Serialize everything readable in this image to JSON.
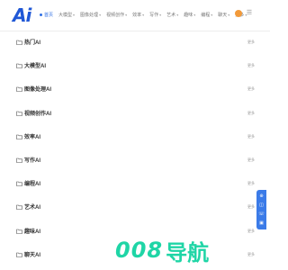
{
  "header": {
    "logo": "Ai",
    "nav": [
      {
        "label": "首页",
        "active": true,
        "has_caret": false
      },
      {
        "label": "大模型",
        "active": false,
        "has_caret": true
      },
      {
        "label": "图像处理",
        "active": false,
        "has_caret": true
      },
      {
        "label": "视频创作",
        "active": false,
        "has_caret": true
      },
      {
        "label": "效率",
        "active": false,
        "has_caret": true
      },
      {
        "label": "写作",
        "active": false,
        "has_caret": true
      },
      {
        "label": "艺术",
        "active": false,
        "has_caret": true
      },
      {
        "label": "趣味",
        "active": false,
        "has_caret": true
      },
      {
        "label": "编程",
        "active": false,
        "has_caret": true
      },
      {
        "label": "聊天",
        "active": false,
        "has_caret": true
      },
      {
        "label": "更多",
        "active": false,
        "has_caret": true
      }
    ]
  },
  "sections": [
    {
      "title": "热门AI",
      "more": "更多"
    },
    {
      "title": "大模型AI",
      "more": "更多"
    },
    {
      "title": "图像处理AI",
      "more": "更多"
    },
    {
      "title": "视频创作AI",
      "more": "更多"
    },
    {
      "title": "效率AI",
      "more": "更多"
    },
    {
      "title": "写作AI",
      "more": "更多"
    },
    {
      "title": "编程AI",
      "more": "更多"
    },
    {
      "title": "艺术AI",
      "more": "更多"
    },
    {
      "title": "趣味AI",
      "more": "更多"
    },
    {
      "title": "聊天AI",
      "more": "更多"
    }
  ],
  "side_tool": [
    "⊕",
    "◫",
    "☏",
    "▣"
  ],
  "watermark": {
    "number": "008",
    "text": "导航"
  },
  "colors": {
    "logo": "#1f57d6",
    "nav_active": "#2f6fe4",
    "side_tool": "#3b7be8",
    "watermark": "#1fd5a6",
    "avatar": "#f29a3a"
  }
}
